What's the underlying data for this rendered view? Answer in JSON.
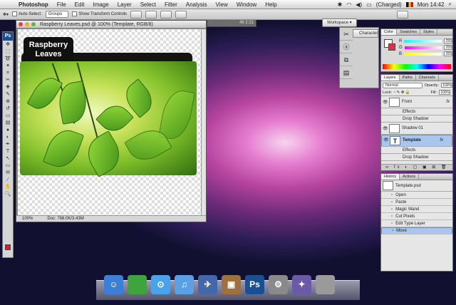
{
  "menubar": {
    "apple": "",
    "app": "Photoshop",
    "items": [
      "File",
      "Edit",
      "Image",
      "Layer",
      "Select",
      "Filter",
      "Analysis",
      "View",
      "Window",
      "Help"
    ],
    "battery": "(Charged)",
    "clock": "Mon 14:42"
  },
  "options": {
    "auto_select_label": "Auto-Select:",
    "auto_select_value": "Groups",
    "transform_label": "Show Transform Controls",
    "workspace": "Workspace"
  },
  "tools": {
    "header": "Ps",
    "icons": [
      "move",
      "marquee",
      "lasso",
      "wand",
      "crop",
      "slice",
      "heal",
      "brush",
      "stamp",
      "history-brush",
      "eraser",
      "gradient",
      "blur",
      "dodge",
      "pen",
      "type",
      "path-select",
      "shape",
      "notes",
      "eyedropper",
      "hand",
      "zoom"
    ],
    "glyphs": [
      "✥",
      "⬚",
      "➰",
      "✦",
      "⌗",
      "✂",
      "✚",
      "✎",
      "⊕",
      "↺",
      "▭",
      "▤",
      "●",
      "◐",
      "✒",
      "T",
      "↖",
      "▭",
      "✉",
      "⁄",
      "✋",
      "🔍"
    ]
  },
  "document": {
    "title": "Raspberry Leaves.psd @ 100% (Template, RGB/8)",
    "zoom": "100%",
    "doc_size": "Doc: 768.0K/3.43M",
    "folder_label_line1": "Raspberry",
    "folder_label_line2": "Leaves"
  },
  "navigator": {
    "text": "49   2:21"
  },
  "character": {
    "label": "Character"
  },
  "color_panel": {
    "tabs": [
      "Color",
      "Swatches",
      "Styles"
    ],
    "rows": [
      {
        "ch": "R",
        "val": "255"
      },
      {
        "ch": "G",
        "val": "255"
      },
      {
        "ch": "B",
        "val": "255"
      }
    ]
  },
  "layers_panel": {
    "tabs": [
      "Layers",
      "Paths",
      "Channels"
    ],
    "blend_mode": "Normal",
    "opacity_label": "Opacity:",
    "opacity": "100%",
    "lock_label": "Lock:",
    "fill_label": "Fill:",
    "fill": "100%",
    "layers": [
      {
        "kind": "layer",
        "name": "Front",
        "fx": "fx"
      },
      {
        "kind": "sub",
        "name": "Effects"
      },
      {
        "kind": "sub",
        "name": "Drop Shadow"
      },
      {
        "kind": "layer",
        "name": "Shadow 01",
        "fx": ""
      },
      {
        "kind": "layer",
        "name": "Template",
        "fx": "fx",
        "selected": true
      },
      {
        "kind": "sub",
        "name": "Effects"
      },
      {
        "kind": "sub",
        "name": "Drop Shadow"
      }
    ]
  },
  "history_panel": {
    "tabs": [
      "History",
      "Actions"
    ],
    "snapshot": "Template.psd",
    "items": [
      "Open",
      "Paste",
      "Magic Wand",
      "Cut Pixels",
      "Edit Type Layer",
      "Move"
    ],
    "selected": "Move"
  },
  "dock": {
    "items": [
      "Finder",
      "Adium",
      "Safari",
      "iTunes",
      "Preview",
      "iPhoto",
      "Photoshop",
      "System Preferences",
      "iMovie",
      "Trash"
    ],
    "labels": [
      "☺",
      "",
      "⊙",
      "♫",
      "✈",
      "▣",
      "Ps",
      "⚙",
      "✦",
      ""
    ]
  },
  "colors": {
    "accent": "#1b4f92",
    "selection": "#a9c6ef"
  }
}
